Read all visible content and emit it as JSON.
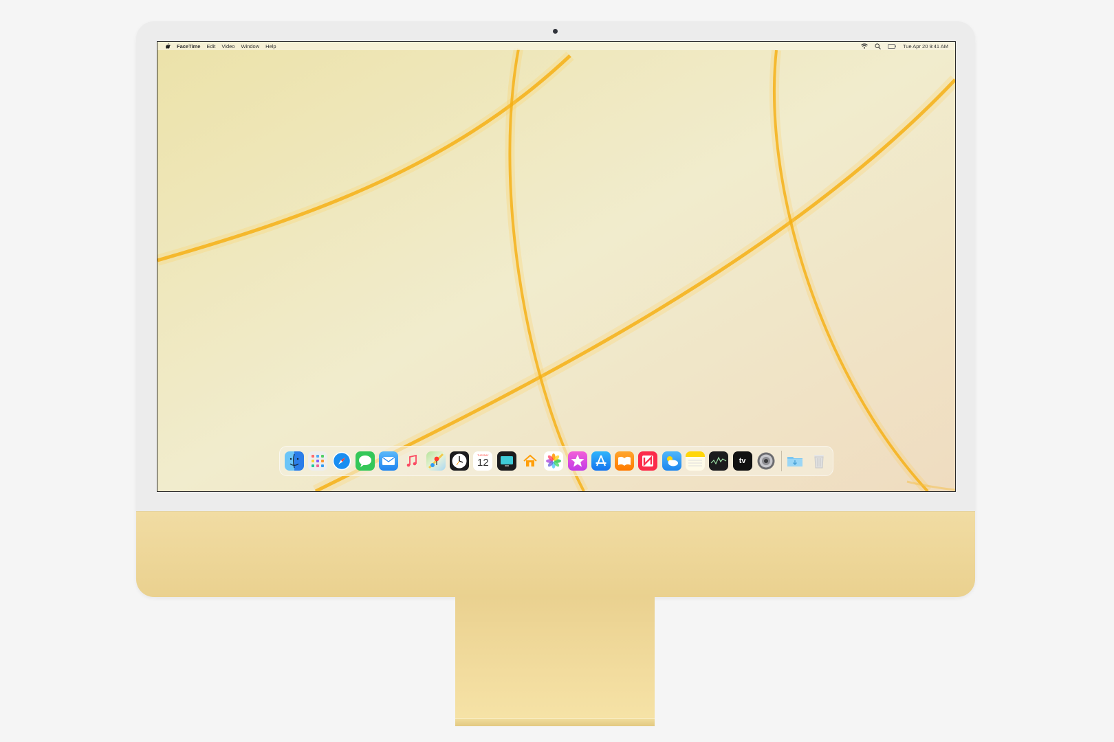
{
  "menubar": {
    "app_name": "FaceTime",
    "menus": [
      "Edit",
      "Video",
      "Window",
      "Help"
    ],
    "clock": "Tue Apr 20  9:41 AM",
    "status_icons": [
      "wifi-icon",
      "spotlight-search-icon",
      "battery-icon"
    ]
  },
  "dock": {
    "items": [
      {
        "name": "finder-icon",
        "color": "#3d9cf0"
      },
      {
        "name": "launchpad-icon",
        "color": "#e6e6e6"
      },
      {
        "name": "safari-icon",
        "color": "#1a8ef1"
      },
      {
        "name": "messages-icon",
        "color": "#34c759"
      },
      {
        "name": "mail-icon",
        "color": "#2f9cf5"
      },
      {
        "name": "music-icon",
        "color": "#fb4a62"
      },
      {
        "name": "maps-icon",
        "color": "#6fcf5f"
      },
      {
        "name": "clock-icon",
        "color": "#1c1c1e"
      },
      {
        "name": "calendar-icon",
        "color": "#ffffff",
        "month": "TUESDAY",
        "day": "12"
      },
      {
        "name": "tv-icon",
        "color": "#1c1c1e"
      },
      {
        "name": "home-icon",
        "color": "#ff9f0a"
      },
      {
        "name": "photos-icon",
        "color": "#ffffff"
      },
      {
        "name": "itunes-store-icon",
        "color": "#e93fc8"
      },
      {
        "name": "app-store-icon",
        "color": "#1d8ef7"
      },
      {
        "name": "books-icon",
        "color": "#ff8f00"
      },
      {
        "name": "news-icon",
        "color": "#fb2b4a"
      },
      {
        "name": "weather-icon",
        "color": "#3aa3f5"
      },
      {
        "name": "notes-icon",
        "color": "#fff4b8"
      },
      {
        "name": "stocks-icon",
        "color": "#1c1c1e"
      },
      {
        "name": "apple-tv-icon",
        "color": "#111111",
        "label": "tv"
      },
      {
        "name": "system-preferences-icon",
        "color": "#8e8e93"
      },
      {
        "name": "downloads-folder-icon",
        "color": "#8ccdf1"
      },
      {
        "name": "trash-icon",
        "color": "#d8d8d8"
      }
    ]
  }
}
